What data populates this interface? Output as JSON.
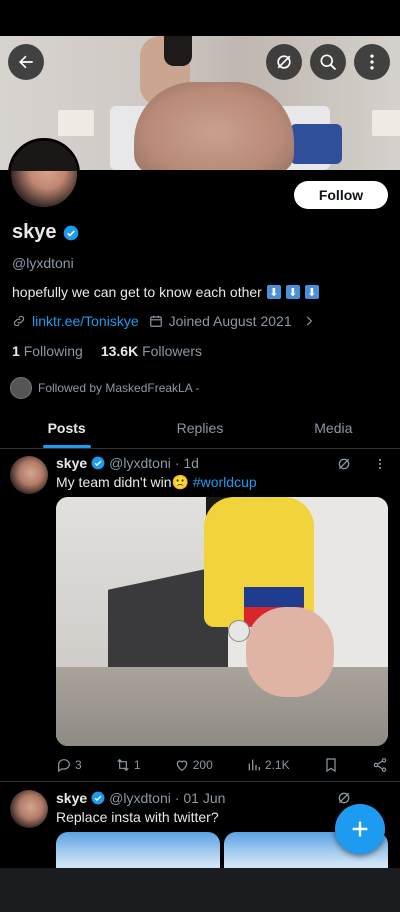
{
  "profile": {
    "name": "skye",
    "handle": "@lyxdtoni",
    "bio": "hopefully we can get to know each other",
    "bio_arrows": [
      "⬇",
      "⬇",
      "⬇"
    ],
    "link": "linktr.ee/Toniskye",
    "joined": "Joined August 2021",
    "following_count": "1",
    "following_label": "Following",
    "followers_count": "13.6K",
    "followers_label": "Followers",
    "followed_by": "Followed by MaskedFreakLA -",
    "follow_button": "Follow"
  },
  "tabs": [
    "Posts",
    "Replies",
    "Media"
  ],
  "active_tab": "Posts",
  "posts": [
    {
      "name": "skye",
      "handle": "@lyxdtoni",
      "time": "· 1d",
      "text": "My team didn't win🙁",
      "hashtag": "#worldcup",
      "replies": "3",
      "reposts": "1",
      "likes": "200",
      "views": "2.1K"
    },
    {
      "name": "skye",
      "handle": "@lyxdtoni",
      "time": "· 01 Jun",
      "text": "Replace insta with twitter?"
    }
  ],
  "colors": {
    "accent": "#1d9bf0",
    "background": "#000000",
    "muted_text": "#8b98a5"
  },
  "icons": [
    "back-arrow-icon",
    "no-grok-icon",
    "search-icon",
    "more-vertical-icon",
    "verified-badge-icon",
    "link-icon",
    "calendar-icon",
    "chevron-right-icon",
    "reply-icon",
    "repost-icon",
    "like-icon",
    "views-icon",
    "bookmark-icon",
    "share-icon",
    "compose-plus-icon"
  ]
}
